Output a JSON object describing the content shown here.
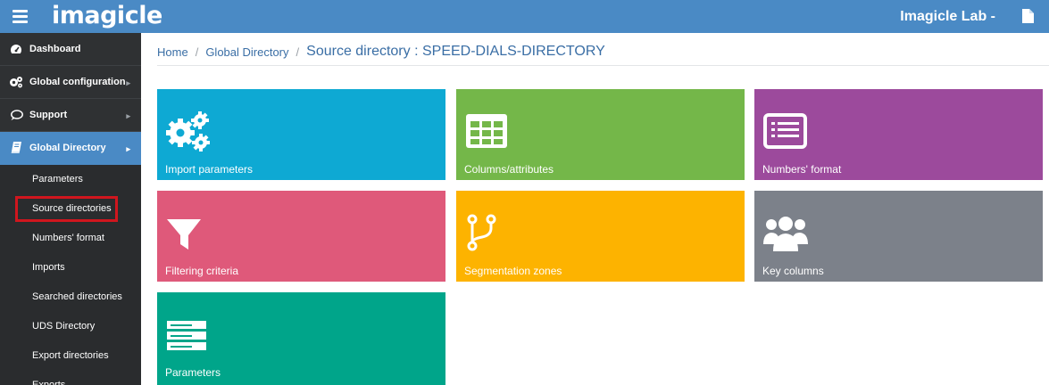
{
  "header": {
    "brand": "imagicle",
    "lab_label": "Imagicle Lab -",
    "menu_icon": "hamburger-menu-icon",
    "doc_icon": "document-icon",
    "bar_color": "#4a8ac5"
  },
  "sidebar": {
    "items": [
      {
        "label": "Dashboard",
        "icon": "dashboard-gauge-icon"
      },
      {
        "label": "Global configuration",
        "icon": "gears-icon"
      },
      {
        "label": "Support",
        "icon": "speech-bubble-icon"
      },
      {
        "label": "Global Directory",
        "icon": "book-icon",
        "active": true
      }
    ],
    "subitems": [
      {
        "label": "Parameters"
      },
      {
        "label": "Source directories",
        "highlighted": true
      },
      {
        "label": "Numbers' format"
      },
      {
        "label": "Imports"
      },
      {
        "label": "Searched directories"
      },
      {
        "label": "UDS Directory"
      },
      {
        "label": "Export directories"
      },
      {
        "label": "Exports"
      }
    ],
    "highlight_color": "#d0161e"
  },
  "breadcrumb": {
    "home": "Home",
    "section": "Global Directory",
    "current": "Source directory : SPEED-DIALS-DIRECTORY",
    "separator": "/"
  },
  "tiles": [
    {
      "label": "Import parameters",
      "icon": "gears-icon",
      "color": "#0ea9d3"
    },
    {
      "label": "Columns/attributes",
      "icon": "table-grid-icon",
      "color": "#74b749"
    },
    {
      "label": "Numbers' format",
      "icon": "list-card-icon",
      "color": "#9c4a9c"
    },
    {
      "label": "Filtering criteria",
      "icon": "funnel-filter-icon",
      "color": "#df597a"
    },
    {
      "label": "Segmentation zones",
      "icon": "branch-fork-icon",
      "color": "#fdb300"
    },
    {
      "label": "Key columns",
      "icon": "users-group-icon",
      "color": "#7c818a"
    },
    {
      "label": "Parameters",
      "icon": "server-stack-icon",
      "color": "#00a58a"
    }
  ]
}
